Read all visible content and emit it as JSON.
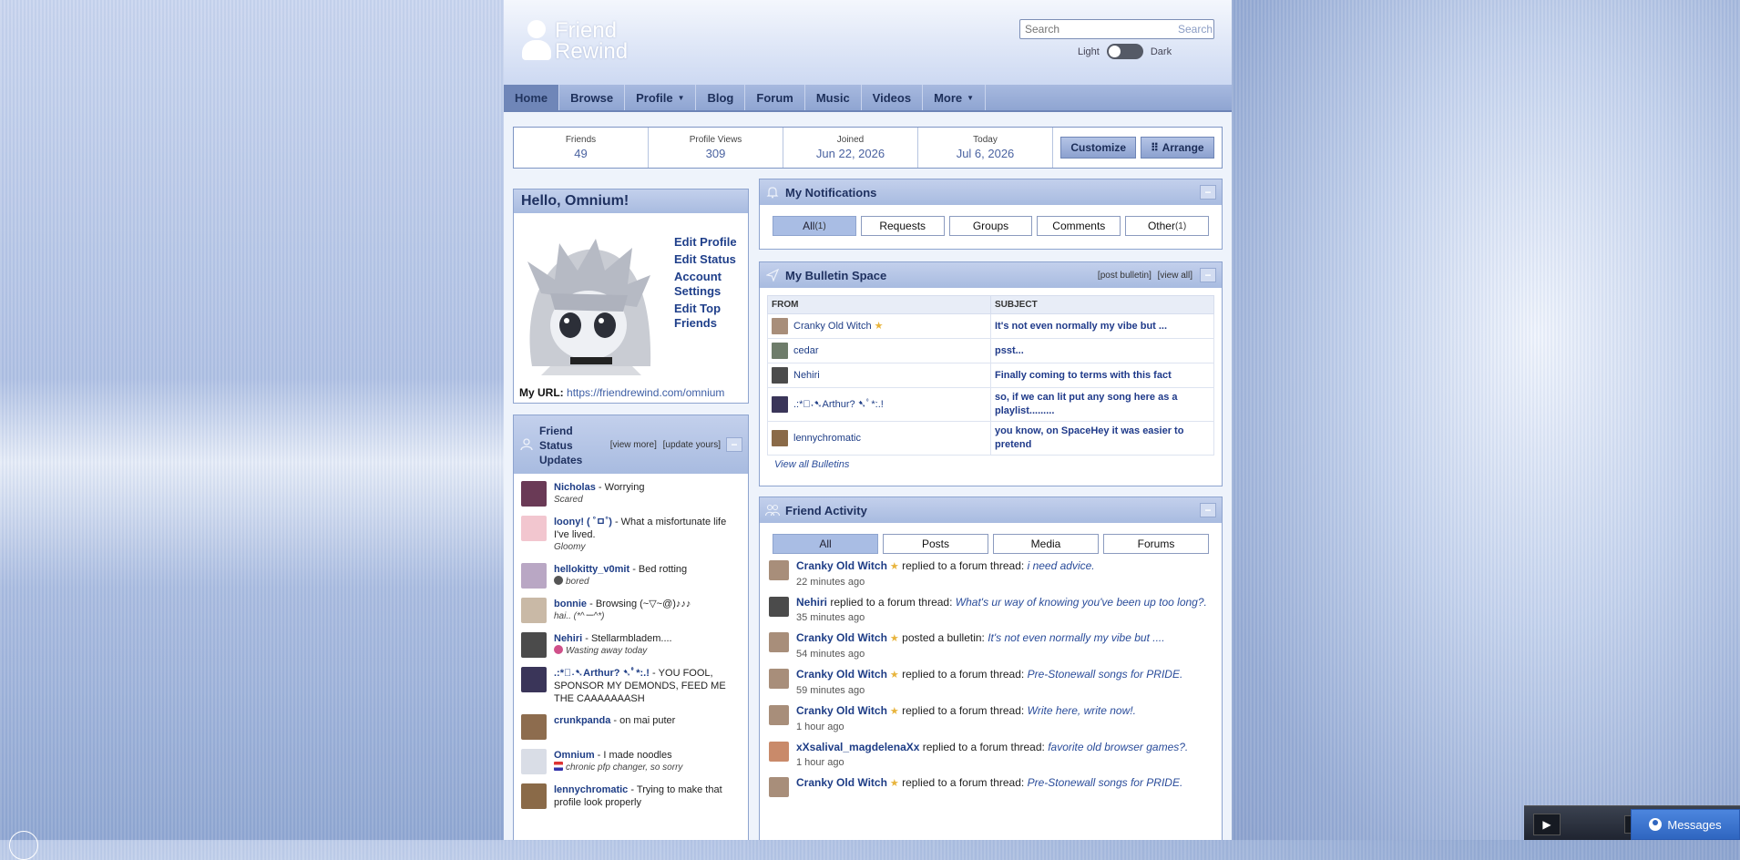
{
  "header": {
    "logo_line1": "Friend",
    "logo_line2": "Rewind",
    "search_placeholder": "Search",
    "search_button": "Search",
    "theme_light": "Light",
    "theme_dark": "Dark"
  },
  "nav": {
    "items": [
      {
        "label": "Home"
      },
      {
        "label": "Browse"
      },
      {
        "label": "Profile",
        "caret": "▼"
      },
      {
        "label": "Blog"
      },
      {
        "label": "Forum"
      },
      {
        "label": "Music"
      },
      {
        "label": "Videos"
      },
      {
        "label": "More",
        "caret": "▼"
      }
    ]
  },
  "stats": {
    "friends_label": "Friends",
    "friends_value": "49",
    "views_label": "Profile Views",
    "views_value": "309",
    "joined_label": "Joined",
    "joined_value": "Jun 22, 2026",
    "today_label": "Today",
    "today_value": "Jul 6, 2026",
    "customize_button": "Customize",
    "arrange_button": "⠿ Arrange"
  },
  "hello": {
    "title": "Hello, Omnium!",
    "links": [
      "Edit Profile",
      "Edit Status",
      "Account Settings",
      "Edit Top Friends"
    ],
    "url_label": "My URL:",
    "url": "https://friendrewind.com/omnium"
  },
  "status_panel": {
    "title": "Friend Status Updates",
    "view_more": "[view more]",
    "update_yours": "[update yours]",
    "items": [
      {
        "name": "Nicholas",
        "text": " - Worrying",
        "mood": "Scared",
        "color": "#6a3a56"
      },
      {
        "name": "loony! ( ˚ㅁ˚)",
        "text": " - What a misfortunate life I've lived.",
        "mood": "Gloomy",
        "color": "#f2c6cf"
      },
      {
        "name": "hellokitty_v0mit",
        "text": " - Bed rotting",
        "mood": "bored",
        "color": "#b9a7c4"
      },
      {
        "name": "bonnie",
        "text": " - Browsing (~▽~@)♪♪♪",
        "mood": "hai.. (*^ー^*)",
        "color": "#c9b9a6"
      },
      {
        "name": "Nehiri",
        "text": " - Stellarmbladem....",
        "mood": "Wasting away today",
        "color": "#4b4b4b"
      },
      {
        "name": ".:*ﾟ˖➷Arthur? ➷ﾟ*:.!",
        "text": " - YOU FOOL, SPONSOR MY DEMONDS, FEED ME THE CAAAAAAASH",
        "mood": "",
        "color": "#3a3559"
      },
      {
        "name": "crunkpanda",
        "text": " - on mai puter",
        "mood": "",
        "color": "#8d6c4e"
      },
      {
        "name": "Omnium",
        "text": " - I made noodles",
        "mood": "chronic pfp changer, so sorry",
        "color": "#d9dde6"
      },
      {
        "name": "lennychromatic",
        "text": " - Trying to make that profile look properly",
        "mood": "",
        "color": "#8a6a48"
      }
    ]
  },
  "notifications": {
    "title": "My Notifications",
    "tabs": [
      {
        "label": "All",
        "count": "(1)"
      },
      {
        "label": "Requests",
        "count": ""
      },
      {
        "label": "Groups",
        "count": ""
      },
      {
        "label": "Comments",
        "count": ""
      },
      {
        "label": "Other",
        "count": "(1)"
      }
    ]
  },
  "bulletins": {
    "title": "My Bulletin Space",
    "post_link": "[post bulletin]",
    "view_link": "[view all]",
    "col_from": "FROM",
    "col_subject": "SUBJECT",
    "rows": [
      {
        "from": "Cranky Old Witch",
        "star": "★",
        "subject": "It's not even normally my vibe but ...",
        "color": "#a88e7a"
      },
      {
        "from": "cedar",
        "star": "",
        "subject": "psst...",
        "color": "#6e7c6a"
      },
      {
        "from": "Nehiri",
        "star": "",
        "subject": "Finally coming to terms with this fact",
        "color": "#4b4b4b"
      },
      {
        "from": ".:*ﾟ˖➷Arthur? ➷ﾟ*:.!",
        "star": "",
        "subject": "so, if we can lit put any song here as a playlist.........",
        "color": "#3a3559"
      },
      {
        "from": "lennychromatic",
        "star": "",
        "subject": "you know, on SpaceHey it was easier to pretend",
        "color": "#8a6a48"
      }
    ],
    "view_all": "View all Bulletins"
  },
  "activity": {
    "title": "Friend Activity",
    "tabs": [
      "All",
      "Posts",
      "Media",
      "Forums"
    ],
    "items": [
      {
        "name": "Cranky Old Witch",
        "star": "★",
        "action": "replied to a forum thread:",
        "object": "i need advice.",
        "time": "22 minutes ago",
        "color": "#a88e7a"
      },
      {
        "name": "Nehiri",
        "star": "",
        "action": "replied to a forum thread:",
        "object": "What's ur way of knowing you've been up too long?.",
        "time": "35 minutes ago",
        "color": "#4b4b4b"
      },
      {
        "name": "Cranky Old Witch",
        "star": "★",
        "action": "posted a bulletin:",
        "object": "It's not even normally my vibe but ....",
        "time": "54 minutes ago",
        "color": "#a88e7a"
      },
      {
        "name": "Cranky Old Witch",
        "star": "★",
        "action": "replied to a forum thread:",
        "object": "Pre-Stonewall songs for PRIDE.",
        "time": "59 minutes ago",
        "color": "#a88e7a"
      },
      {
        "name": "Cranky Old Witch",
        "star": "★",
        "action": "replied to a forum thread:",
        "object": "Write here, write now!.",
        "time": "1 hour ago",
        "color": "#a88e7a"
      },
      {
        "name": "xXsalival_magdelenaXx",
        "star": "",
        "action": "replied to a forum thread:",
        "object": "favorite old browser games?.",
        "time": "1 hour ago",
        "color": "#c98a6a"
      },
      {
        "name": "Cranky Old Witch",
        "star": "★",
        "action": "replied to a forum thread:",
        "object": "Pre-Stonewall songs for PRIDE.",
        "time": "",
        "color": "#a88e7a"
      }
    ]
  },
  "bottom": {
    "play": "▶",
    "skip": "»",
    "messages": "Messages"
  },
  "colors": {
    "accent": "#1e3d86",
    "nav_bg": "#8fa5d2",
    "panel_head": "#a8bbe0",
    "messages_btn": "#2f66c0"
  }
}
